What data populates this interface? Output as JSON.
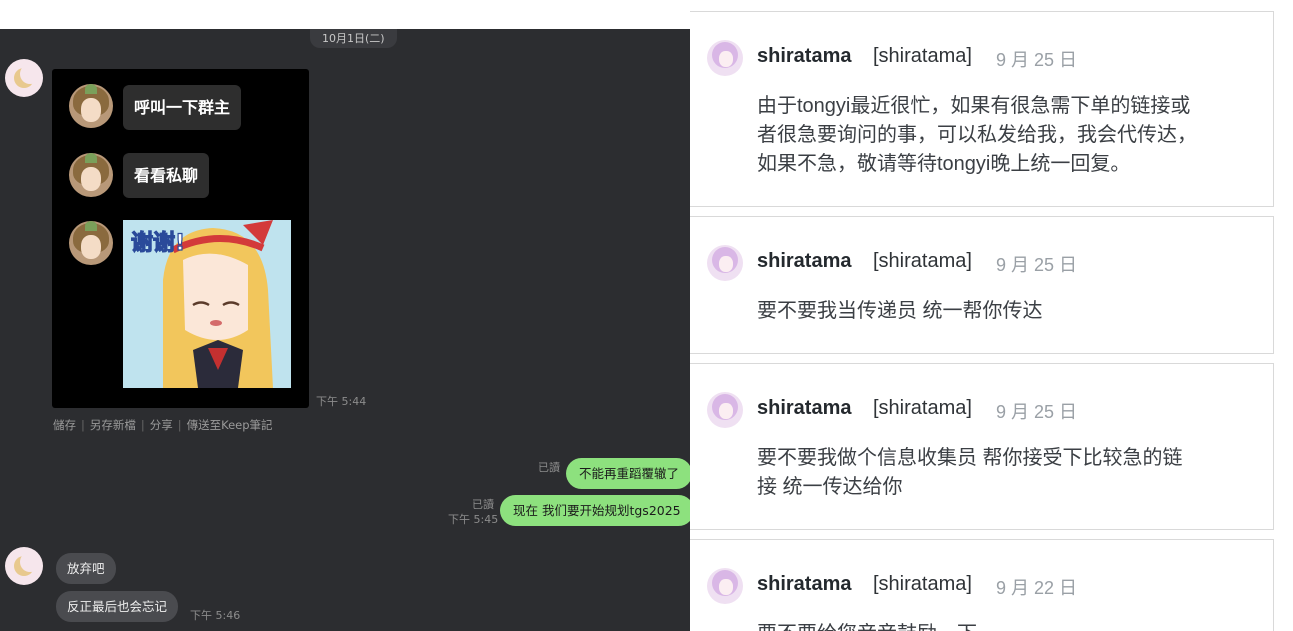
{
  "chat": {
    "date_divider": "10月1日(二)",
    "sticker": {
      "lines": [
        "呼叫一下群主",
        "看看私聊"
      ],
      "art_text": "谢谢!",
      "time": "下午 5:44"
    },
    "image_actions": [
      "儲存",
      "另存新檔",
      "分享",
      "傳送至Keep筆記"
    ],
    "outgoing": [
      {
        "read": "已讀",
        "time": "",
        "text": "不能再重蹈覆辙了"
      },
      {
        "read": "已讀",
        "time": "下午 5:45",
        "text": "现在 我们要开始规划tgs2025"
      }
    ],
    "incoming": [
      {
        "text": "放弃吧"
      },
      {
        "text": "反正最后也会忘记",
        "time": "下午 5:46"
      }
    ]
  },
  "comments": [
    {
      "name": "shiratama",
      "handle": "[shiratama]",
      "date": "9 月 25 日",
      "lines": [
        "由于tongyi最近很忙，如果有很急需下单的链接或",
        "者很急要询问的事，可以私发给我，我会代传达，",
        "如果不急，敬请等待tongyi晚上统一回复。"
      ]
    },
    {
      "name": "shiratama",
      "handle": "[shiratama]",
      "date": "9 月 25 日",
      "lines": [
        "要不要我当传递员 统一帮你传达"
      ]
    },
    {
      "name": "shiratama",
      "handle": "[shiratama]",
      "date": "9 月 25 日",
      "lines": [
        "要不要我做个信息收集员 帮你接受下比较急的链",
        "接 统一传达给你"
      ]
    },
    {
      "name": "shiratama",
      "handle": "[shiratama]",
      "date": "9 月 22 日",
      "lines": [
        "要不要给您音音鼓励一下"
      ]
    }
  ]
}
